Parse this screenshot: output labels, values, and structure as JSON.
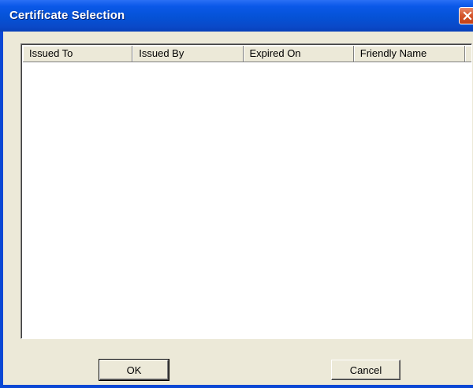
{
  "window": {
    "title": "Certificate Selection",
    "close_icon": "close-icon"
  },
  "list": {
    "columns": [
      "Issued To",
      "Issued By",
      "Expired On",
      "Friendly Name"
    ],
    "rows": []
  },
  "buttons": {
    "ok_label": "OK",
    "cancel_label": "Cancel"
  },
  "colors": {
    "title_bar": "#0552d6",
    "close_button": "#d5582f",
    "dialog_face": "#ece9d8",
    "list_background": "#ffffff"
  }
}
